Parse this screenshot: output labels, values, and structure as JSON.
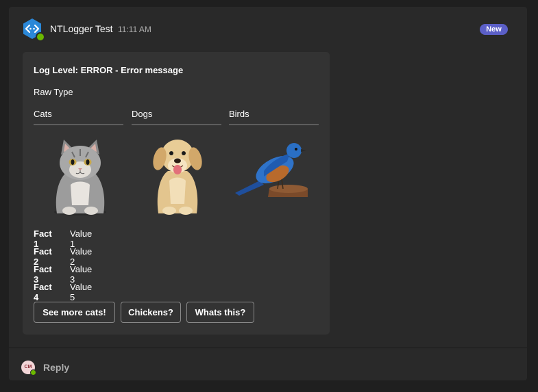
{
  "message": {
    "sender": "NTLogger Test",
    "time": "11:11 AM",
    "badge": "New"
  },
  "card": {
    "title": "Log Level: ERROR - Error message",
    "raw_type": "Raw Type",
    "columns": [
      "Cats",
      "Dogs",
      "Birds"
    ],
    "images": [
      {
        "icon": "cat-image"
      },
      {
        "icon": "dog-image"
      },
      {
        "icon": "bird-image"
      }
    ],
    "facts": [
      {
        "key": "Fact 1",
        "value": "Value 1"
      },
      {
        "key": "Fact 2",
        "value": "Value 2"
      },
      {
        "key": "Fact 3",
        "value": "Value 3"
      },
      {
        "key": "Fact 4",
        "value": "Value 5"
      }
    ],
    "actions": [
      "See more cats!",
      "Chickens?",
      "Whats this?"
    ]
  },
  "reply": {
    "avatar_initials": "CM",
    "label": "Reply"
  },
  "colors": {
    "accent": "#5b5fc7",
    "bot_icon": "#2b88d8",
    "presence": "#6bb700"
  }
}
